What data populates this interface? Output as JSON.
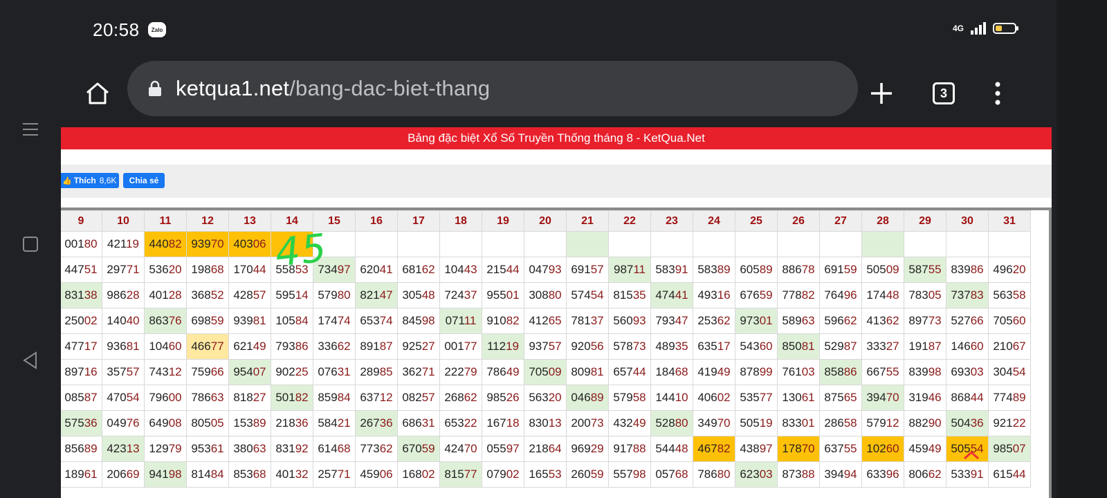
{
  "status": {
    "time": "20:58",
    "zalo_label": "Zalo",
    "network": "4G",
    "battery_level": 0.35
  },
  "browser": {
    "url_domain": "ketqua1.net",
    "url_path": "/bang-dac-biet-thang",
    "tab_count": "3"
  },
  "page": {
    "banner": "Bảng đặc biệt Xổ Số Truyền Thống tháng 8 - KetQua.Net",
    "like_label": "Thích",
    "like_count": "8,6K",
    "share_label": "Chia sẻ",
    "handwritten": "45"
  },
  "colors": {
    "green_cell": "#dff0d8",
    "orange_cell": "#ffc107",
    "pale_yellow_cell": "#ffe8a0",
    "banner": "#e8202c",
    "tail_digits": "#8b1a1a"
  },
  "table": {
    "headers": [
      "9",
      "10",
      "11",
      "12",
      "13",
      "14",
      "15",
      "16",
      "17",
      "18",
      "19",
      "20",
      "21",
      "22",
      "23",
      "24",
      "25",
      "26",
      "27",
      "28",
      "29",
      "30",
      "31"
    ],
    "rows": [
      [
        [
          "00180",
          ""
        ],
        [
          "42119",
          ""
        ],
        [
          "44082",
          "y"
        ],
        [
          "93970",
          "y"
        ],
        [
          "40306",
          "y"
        ],
        [
          "",
          "y"
        ],
        [
          "",
          ""
        ],
        [
          "",
          ""
        ],
        [
          "",
          ""
        ],
        [
          "",
          ""
        ],
        [
          "",
          ""
        ],
        [
          "",
          ""
        ],
        [
          "",
          "g"
        ],
        [
          "",
          ""
        ],
        [
          "",
          ""
        ],
        [
          "",
          ""
        ],
        [
          "",
          ""
        ],
        [
          "",
          ""
        ],
        [
          "",
          ""
        ],
        [
          "",
          "g"
        ],
        [
          "",
          ""
        ],
        [
          "",
          ""
        ],
        [
          "",
          ""
        ]
      ],
      [
        [
          "44751",
          ""
        ],
        [
          "29771",
          ""
        ],
        [
          "53620",
          ""
        ],
        [
          "19868",
          ""
        ],
        [
          "17044",
          ""
        ],
        [
          "55853",
          ""
        ],
        [
          "73497",
          "g"
        ],
        [
          "62041",
          ""
        ],
        [
          "68162",
          ""
        ],
        [
          "10443",
          ""
        ],
        [
          "21544",
          ""
        ],
        [
          "04793",
          ""
        ],
        [
          "69157",
          ""
        ],
        [
          "98711",
          "g"
        ],
        [
          "58391",
          ""
        ],
        [
          "58389",
          ""
        ],
        [
          "60589",
          ""
        ],
        [
          "88678",
          ""
        ],
        [
          "69159",
          ""
        ],
        [
          "50509",
          ""
        ],
        [
          "58755",
          "g"
        ],
        [
          "83986",
          ""
        ],
        [
          "49620",
          ""
        ]
      ],
      [
        [
          "83138",
          "g"
        ],
        [
          "98628",
          ""
        ],
        [
          "40128",
          ""
        ],
        [
          "36852",
          ""
        ],
        [
          "42857",
          ""
        ],
        [
          "59514",
          ""
        ],
        [
          "57980",
          ""
        ],
        [
          "82147",
          "g"
        ],
        [
          "30548",
          ""
        ],
        [
          "72437",
          ""
        ],
        [
          "95501",
          ""
        ],
        [
          "30880",
          ""
        ],
        [
          "57454",
          ""
        ],
        [
          "81535",
          ""
        ],
        [
          "47441",
          "g"
        ],
        [
          "49316",
          ""
        ],
        [
          "67659",
          ""
        ],
        [
          "77882",
          ""
        ],
        [
          "76496",
          ""
        ],
        [
          "17448",
          ""
        ],
        [
          "78305",
          ""
        ],
        [
          "73783",
          "g"
        ],
        [
          "56358",
          ""
        ]
      ],
      [
        [
          "25002",
          ""
        ],
        [
          "14040",
          ""
        ],
        [
          "86376",
          "g"
        ],
        [
          "69859",
          ""
        ],
        [
          "93981",
          ""
        ],
        [
          "10584",
          ""
        ],
        [
          "17474",
          ""
        ],
        [
          "65374",
          ""
        ],
        [
          "84598",
          ""
        ],
        [
          "07111",
          "g"
        ],
        [
          "91082",
          ""
        ],
        [
          "41265",
          ""
        ],
        [
          "78137",
          ""
        ],
        [
          "56093",
          ""
        ],
        [
          "79347",
          ""
        ],
        [
          "25362",
          ""
        ],
        [
          "97301",
          "g"
        ],
        [
          "58963",
          ""
        ],
        [
          "59662",
          ""
        ],
        [
          "41362",
          ""
        ],
        [
          "89773",
          ""
        ],
        [
          "52766",
          ""
        ],
        [
          "70560",
          ""
        ]
      ],
      [
        [
          "47717",
          ""
        ],
        [
          "93681",
          ""
        ],
        [
          "10460",
          ""
        ],
        [
          "46677",
          "p"
        ],
        [
          "62149",
          ""
        ],
        [
          "79386",
          ""
        ],
        [
          "33662",
          ""
        ],
        [
          "89187",
          ""
        ],
        [
          "92527",
          ""
        ],
        [
          "00177",
          ""
        ],
        [
          "11219",
          "g"
        ],
        [
          "93757",
          ""
        ],
        [
          "92056",
          ""
        ],
        [
          "57873",
          ""
        ],
        [
          "48935",
          ""
        ],
        [
          "63517",
          ""
        ],
        [
          "54360",
          ""
        ],
        [
          "85081",
          "g"
        ],
        [
          "52987",
          ""
        ],
        [
          "33327",
          ""
        ],
        [
          "19187",
          ""
        ],
        [
          "14660",
          ""
        ],
        [
          "21067",
          ""
        ]
      ],
      [
        [
          "89716",
          ""
        ],
        [
          "35757",
          ""
        ],
        [
          "74312",
          ""
        ],
        [
          "75966",
          ""
        ],
        [
          "95407",
          "g"
        ],
        [
          "90225",
          ""
        ],
        [
          "07631",
          ""
        ],
        [
          "28985",
          ""
        ],
        [
          "36271",
          ""
        ],
        [
          "22279",
          ""
        ],
        [
          "78649",
          ""
        ],
        [
          "70509",
          "g"
        ],
        [
          "80981",
          ""
        ],
        [
          "65744",
          ""
        ],
        [
          "18468",
          ""
        ],
        [
          "41949",
          ""
        ],
        [
          "87899",
          ""
        ],
        [
          "76103",
          ""
        ],
        [
          "85886",
          "g"
        ],
        [
          "66755",
          ""
        ],
        [
          "83998",
          ""
        ],
        [
          "69303",
          ""
        ],
        [
          "30454",
          ""
        ]
      ],
      [
        [
          "08587",
          ""
        ],
        [
          "47054",
          ""
        ],
        [
          "79600",
          ""
        ],
        [
          "78663",
          ""
        ],
        [
          "81827",
          ""
        ],
        [
          "50182",
          "g"
        ],
        [
          "85984",
          ""
        ],
        [
          "63712",
          ""
        ],
        [
          "08257",
          ""
        ],
        [
          "26862",
          ""
        ],
        [
          "98526",
          ""
        ],
        [
          "56320",
          ""
        ],
        [
          "04689",
          "g"
        ],
        [
          "57958",
          ""
        ],
        [
          "14410",
          ""
        ],
        [
          "40602",
          ""
        ],
        [
          "53577",
          ""
        ],
        [
          "13061",
          ""
        ],
        [
          "87565",
          ""
        ],
        [
          "39470",
          "g"
        ],
        [
          "31946",
          ""
        ],
        [
          "86844",
          ""
        ],
        [
          "77489",
          ""
        ]
      ],
      [
        [
          "57536",
          "g"
        ],
        [
          "04976",
          ""
        ],
        [
          "64908",
          ""
        ],
        [
          "80505",
          ""
        ],
        [
          "15389",
          ""
        ],
        [
          "21836",
          ""
        ],
        [
          "58421",
          ""
        ],
        [
          "26736",
          "g"
        ],
        [
          "68631",
          ""
        ],
        [
          "65322",
          ""
        ],
        [
          "16718",
          ""
        ],
        [
          "83013",
          ""
        ],
        [
          "20073",
          ""
        ],
        [
          "43249",
          ""
        ],
        [
          "52880",
          "g"
        ],
        [
          "34970",
          ""
        ],
        [
          "50519",
          ""
        ],
        [
          "83301",
          ""
        ],
        [
          "28658",
          ""
        ],
        [
          "57912",
          ""
        ],
        [
          "88290",
          ""
        ],
        [
          "50436",
          "g"
        ],
        [
          "92122",
          ""
        ]
      ],
      [
        [
          "85689",
          ""
        ],
        [
          "42313",
          "g"
        ],
        [
          "12979",
          ""
        ],
        [
          "95361",
          ""
        ],
        [
          "38063",
          ""
        ],
        [
          "83192",
          ""
        ],
        [
          "61468",
          ""
        ],
        [
          "77362",
          ""
        ],
        [
          "67059",
          "g"
        ],
        [
          "42470",
          ""
        ],
        [
          "05597",
          ""
        ],
        [
          "21864",
          ""
        ],
        [
          "96929",
          ""
        ],
        [
          "91788",
          ""
        ],
        [
          "54448",
          ""
        ],
        [
          "46782",
          "y"
        ],
        [
          "43897",
          ""
        ],
        [
          "17870",
          "y"
        ],
        [
          "63755",
          ""
        ],
        [
          "10260",
          "y"
        ],
        [
          "45949",
          ""
        ],
        [
          "50554",
          "y"
        ],
        [
          "98507",
          "g"
        ]
      ],
      [
        [
          "18961",
          ""
        ],
        [
          "20669",
          ""
        ],
        [
          "94198",
          "g"
        ],
        [
          "81484",
          ""
        ],
        [
          "85368",
          ""
        ],
        [
          "40132",
          ""
        ],
        [
          "25771",
          ""
        ],
        [
          "45906",
          ""
        ],
        [
          "16802",
          ""
        ],
        [
          "81577",
          "g"
        ],
        [
          "07902",
          ""
        ],
        [
          "16553",
          ""
        ],
        [
          "26059",
          ""
        ],
        [
          "55798",
          ""
        ],
        [
          "05768",
          ""
        ],
        [
          "78680",
          ""
        ],
        [
          "62303",
          "g"
        ],
        [
          "87388",
          ""
        ],
        [
          "39494",
          ""
        ],
        [
          "63396",
          ""
        ],
        [
          "80662",
          ""
        ],
        [
          "53391",
          ""
        ],
        [
          "61544",
          ""
        ]
      ]
    ]
  }
}
